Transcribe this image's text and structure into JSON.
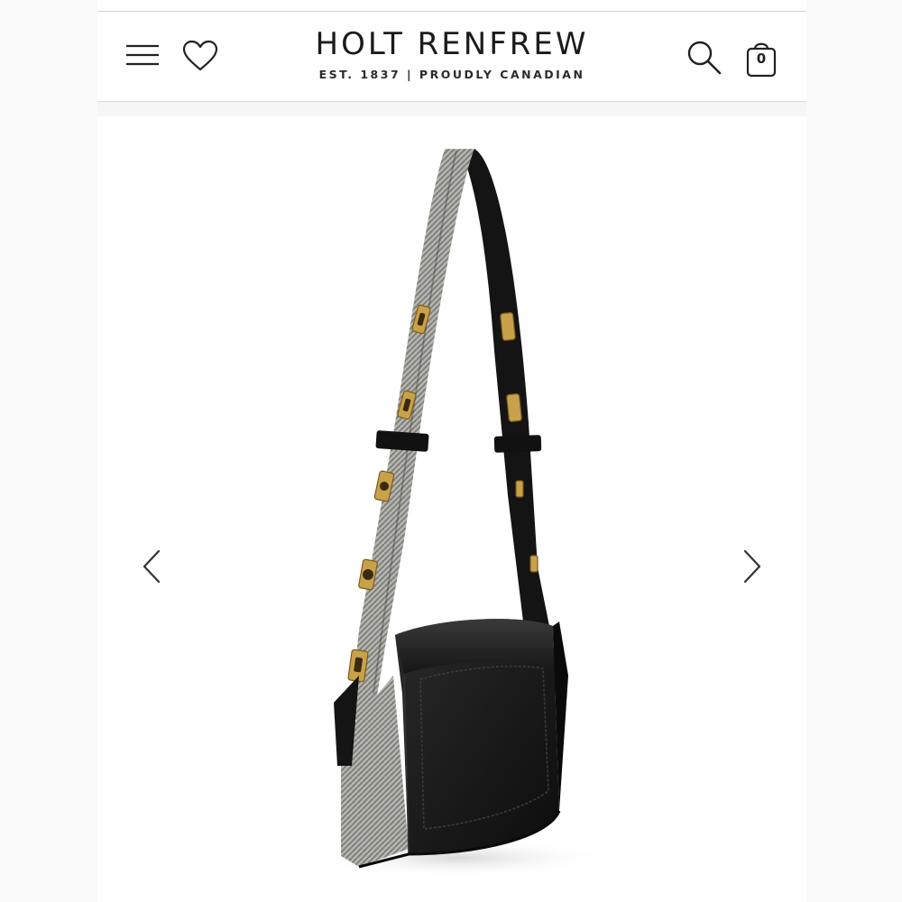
{
  "header": {
    "brand_name": "HOLT RENFREW",
    "brand_tagline": "EST. 1837 | PROUDLY CANADIAN",
    "bag_count": "0",
    "icons": {
      "menu": "hamburger-menu-icon",
      "wishlist": "heart-icon",
      "search": "search-icon",
      "bag": "shopping-bag-icon"
    }
  },
  "gallery": {
    "prev_icon": "chevron-left-icon",
    "next_icon": "chevron-right-icon"
  },
  "colors": {
    "text": "#1b1b1b",
    "divider": "#d6d6d6",
    "bag_leather": "#151515",
    "strap_canvas": "#9a9a95",
    "hardware_gold": "#c8a24a"
  }
}
